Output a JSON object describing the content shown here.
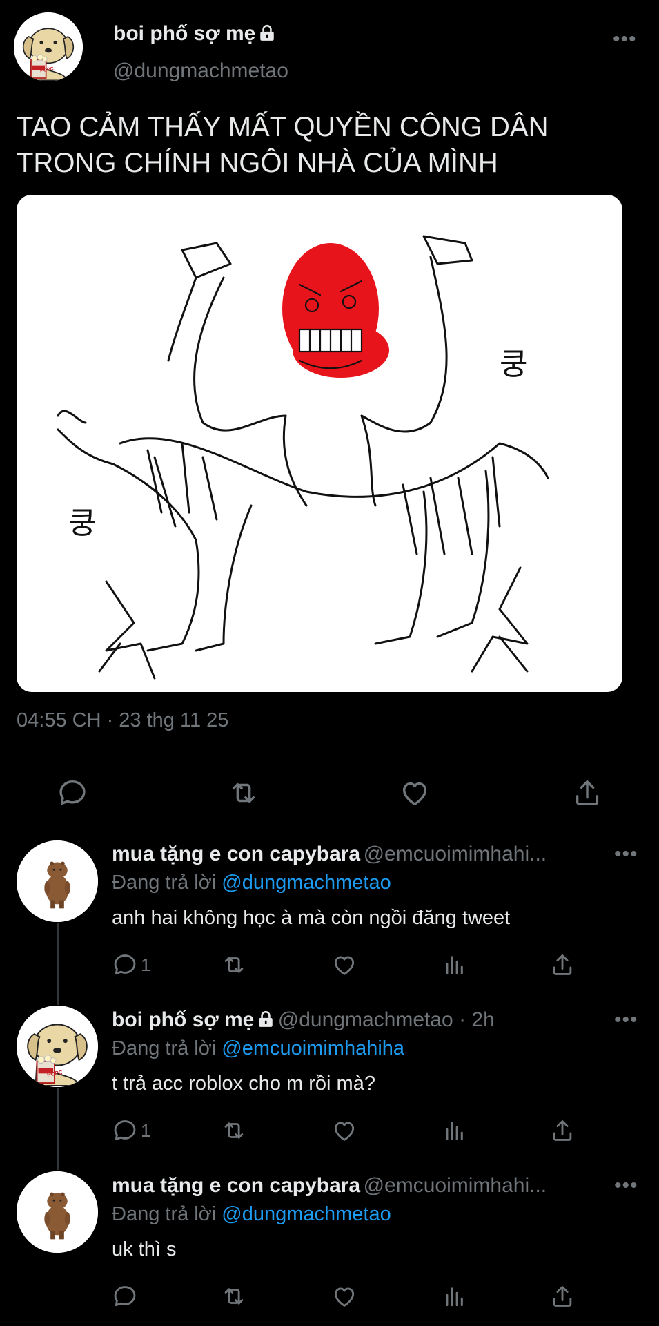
{
  "main_tweet": {
    "display_name": "boi phố sợ mẹ",
    "handle": "@dungmachmetao",
    "text_line1": "TAO CẢM THẤY MẤT QUYỀN CÔNG DÂN",
    "text_line2": "TRONG CHÍNH NGÔI NHÀ CỦA MÌNH",
    "image_text_1": "쿵",
    "image_text_2": "쿵",
    "avatar_text": "POPC",
    "timestamp": "04:55 CH · 23 thg 11 25",
    "more": "•••"
  },
  "replies": [
    {
      "display_name": "mua tặng e con capybara",
      "handle": "@emcuoimimhahi...",
      "replying_label": "Đang trả lời",
      "replying_to": "@dungmachmetao",
      "text": "anh hai không học à mà còn ngồi đăng tweet",
      "reply_count": "1",
      "more": "•••"
    },
    {
      "display_name": "boi phố sợ mẹ",
      "handle": "@dungmachmetao · 2h",
      "replying_label": "Đang trả lời",
      "replying_to": "@emcuoimimhahiha",
      "text": "t trả acc roblox cho m rồi mà?",
      "reply_count": "1",
      "avatar_text": "POPC",
      "more": "•••"
    },
    {
      "display_name": "mua tặng e con capybara",
      "handle": "@emcuoimimhahi...",
      "replying_label": "Đang trả lời",
      "replying_to": "@dungmachmetao",
      "text": "uk thì s",
      "reply_count": "",
      "more": "•••"
    }
  ],
  "icons": {
    "reply": "reply-icon",
    "retweet": "retweet-icon",
    "like": "like-icon",
    "share": "share-icon",
    "views": "views-icon",
    "lock": "lock-icon",
    "more": "more-icon"
  },
  "colors": {
    "background": "#000000",
    "text": "#e7e9ea",
    "secondary": "#71767b",
    "link": "#1d9bf0",
    "divider": "#2f3336",
    "face_red": "#e8141b"
  }
}
